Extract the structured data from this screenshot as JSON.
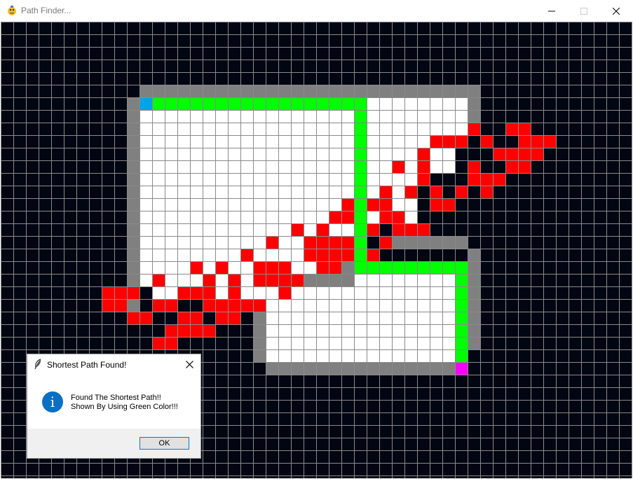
{
  "window": {
    "title": "Path Finder...",
    "icon": "pygame-snake-icon"
  },
  "grid": {
    "cols": 50,
    "rows": 36,
    "colors": {
      "background": "#010612",
      "gridline": "#8a8a8a",
      "empty": "#ffffff",
      "wall": "#808080",
      "explored": "#ff0000",
      "path": "#00ff00",
      "start": "#00a2e8",
      "end": "#ff00ff"
    },
    "walls": [
      "11,5,37,5",
      "10,6,10,20",
      "37,6,37,7",
      "10,22,10,22",
      "30,17,36,17",
      "37,18,37,25",
      "23,20,26,20",
      "27,18,27,20",
      "20,22,20,26",
      "21,27,35,27"
    ],
    "white": [
      "11,6,11,20",
      "11,7,28,7",
      "12,8,27,21",
      "29,6,36,8",
      "29,9,32,15",
      "33,9,35,11",
      "21,21,27,26",
      "28,19,36,26",
      "21,21,36,26"
    ],
    "explored": [
      "37,8",
      "40,8",
      "41,8",
      "34,9",
      "35,9",
      "36,9",
      "38,9",
      "41,9",
      "42,9",
      "43,9",
      "33,10",
      "39,10",
      "40,10",
      "41,10",
      "42,10",
      "31,11",
      "33,11",
      "37,11",
      "40,11",
      "41,11",
      "33,12",
      "37,12",
      "38,12",
      "39,12",
      "30,13",
      "32,13",
      "34,13",
      "36,13",
      "38,13",
      "27,14",
      "29,14",
      "30,14",
      "34,14",
      "35,14",
      "26,15",
      "27,15",
      "28,15",
      "30,15",
      "31,15",
      "23,16",
      "25,16",
      "29,16",
      "31,16",
      "32,16",
      "33,16",
      "21,17",
      "24,17",
      "25,17",
      "26,17",
      "27,17",
      "28,17",
      "30,17",
      "19,18",
      "24,18",
      "25,18",
      "26,18",
      "27,18",
      "29,18",
      "15,19",
      "17,19",
      "20,19",
      "21,19",
      "22,19",
      "25,19",
      "26,19",
      "12,20",
      "16,20",
      "18,20",
      "20,20",
      "21,20",
      "22,20",
      "23,20",
      "8,21",
      "9,21",
      "10,21",
      "14,21",
      "15,21",
      "16,21",
      "18,21",
      "22,21",
      "8,22",
      "9,22",
      "12,22",
      "13,22",
      "16,22",
      "17,22",
      "18,22",
      "19,22",
      "20,22",
      "10,23",
      "11,23",
      "14,23",
      "15,23",
      "17,23",
      "18,23",
      "13,24",
      "14,24",
      "15,24",
      "16,24",
      "12,25",
      "13,25"
    ],
    "path": [
      "12,6,28,6",
      "28,6,28,19",
      "28,19,36,19",
      "36,19,36,26"
    ],
    "start": "11,6",
    "end": "36,27"
  },
  "dialog": {
    "title": "Shortest Path Found!",
    "message_line1": "Found The Shortest Path!!",
    "message_line2": "Shown By Using Green Color!!!",
    "info_glyph": "i",
    "ok_label": "OK"
  }
}
